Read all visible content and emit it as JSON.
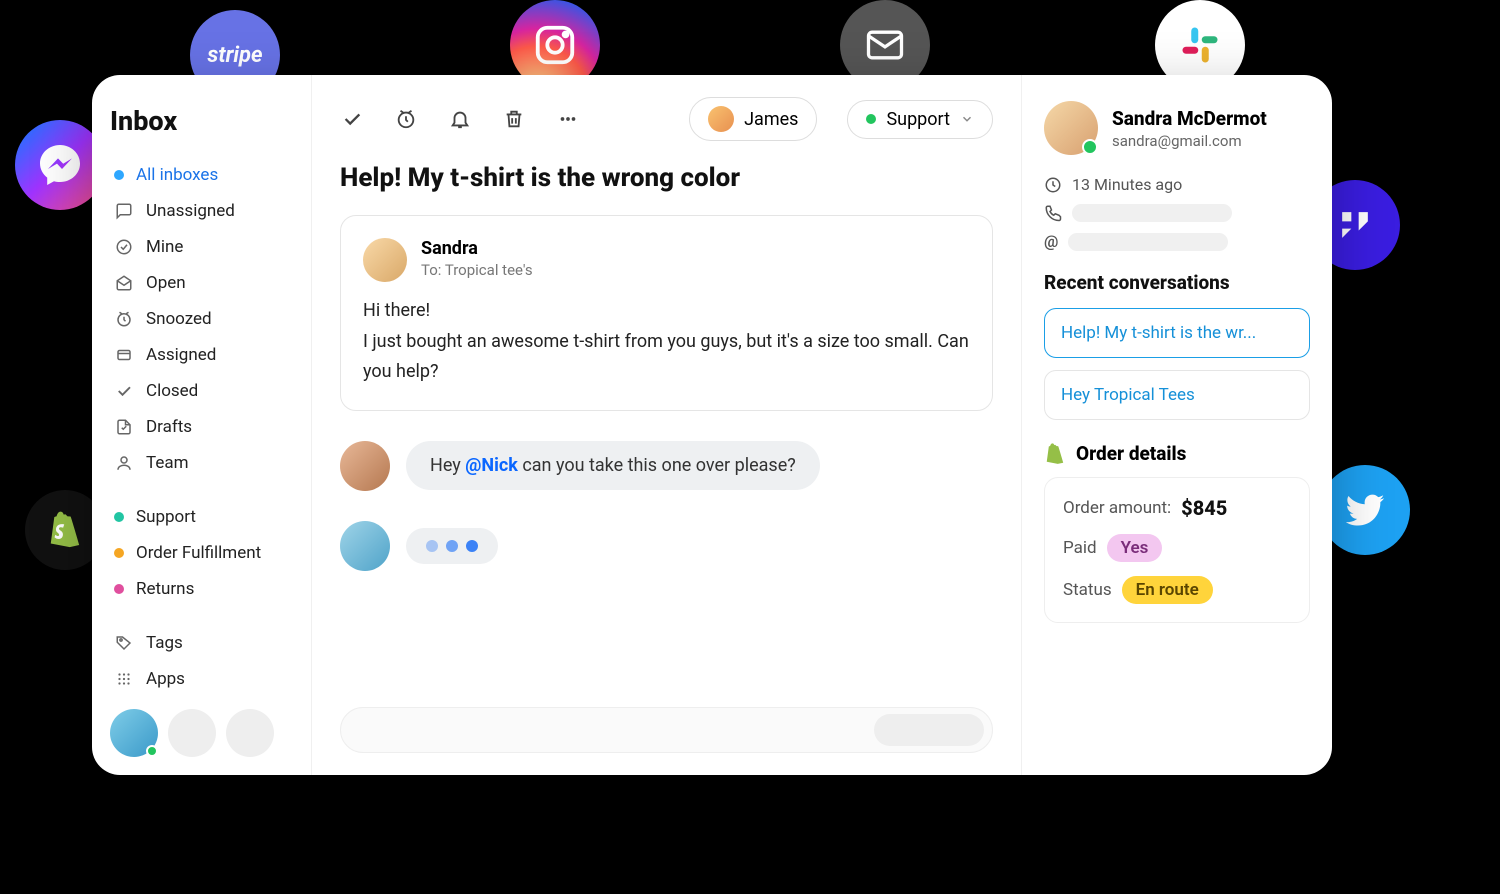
{
  "sidebar": {
    "title": "Inbox",
    "items": [
      {
        "label": "All inboxes",
        "icon": "dot",
        "color": "#2ea7ff",
        "active": true
      },
      {
        "label": "Unassigned",
        "icon": "message"
      },
      {
        "label": "Mine",
        "icon": "check-circle"
      },
      {
        "label": "Open",
        "icon": "open"
      },
      {
        "label": "Snoozed",
        "icon": "clock"
      },
      {
        "label": "Assigned",
        "icon": "assigned"
      },
      {
        "label": "Closed",
        "icon": "check"
      },
      {
        "label": "Drafts",
        "icon": "draft"
      },
      {
        "label": "Team",
        "icon": "person"
      }
    ],
    "teams": [
      {
        "label": "Support",
        "color": "#22c5a3"
      },
      {
        "label": "Order Fulfillment",
        "color": "#f5a623"
      },
      {
        "label": "Returns",
        "color": "#e04f9e"
      }
    ],
    "footer": [
      {
        "label": "Tags",
        "icon": "tag"
      },
      {
        "label": "Apps",
        "icon": "grid"
      }
    ]
  },
  "toolbar": {
    "assignee": "James",
    "team": "Support"
  },
  "conversation": {
    "subject": "Help! My t-shirt is the wrong color",
    "message": {
      "from": "Sandra",
      "to": "To: Tropical tee's",
      "body_line1": "Hi there!",
      "body_line2": "I just bought an awesome t-shirt from you guys, but it's a size too small. Can you help?"
    },
    "note": {
      "pre": "Hey ",
      "mention": "@Nick",
      "post": " can you take this one over please?"
    }
  },
  "customer": {
    "name": "Sandra McDermot",
    "email": "sandra@gmail.com",
    "last_seen": "13 Minutes ago"
  },
  "recent": {
    "title": "Recent conversations",
    "items": [
      "Help! My t-shirt is the wr...",
      "Hey Tropical Tees"
    ]
  },
  "order": {
    "title": "Order details",
    "amount_label": "Order amount:",
    "amount": "$845",
    "paid_label": "Paid",
    "paid": "Yes",
    "status_label": "Status",
    "status": "En route"
  },
  "integrations": {
    "stripe": "stripe"
  }
}
